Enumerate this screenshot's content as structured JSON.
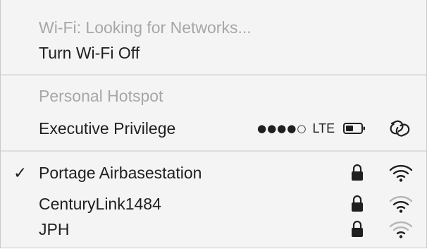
{
  "wifi_status": {
    "label": "Wi-Fi: Looking for Networks..."
  },
  "wifi_toggle": {
    "label": "Turn Wi-Fi Off"
  },
  "hotspot_section": {
    "header": "Personal Hotspot",
    "device": {
      "name": "Executive Privilege",
      "signal_dots": "●●●●○",
      "network_type": "LTE",
      "icons": [
        "battery-icon",
        "link-icon"
      ]
    }
  },
  "networks": [
    {
      "name": "Portage Airbasestation",
      "connected": true,
      "check": "✓",
      "secured": true,
      "icons": [
        "lock-icon",
        "wifi-signal-icon"
      ]
    },
    {
      "name": "CenturyLink1484",
      "connected": false,
      "secured": true,
      "icons": [
        "lock-icon",
        "wifi-signal-icon"
      ]
    },
    {
      "name": "JPH",
      "connected": false,
      "secured": true,
      "icons": [
        "lock-icon",
        "wifi-signal-icon"
      ]
    }
  ],
  "colors": {
    "background": "#f4f4f4",
    "text": "#1f1f1f",
    "header_text": "#a7a7a7",
    "separator": "#dedede",
    "wifi_dim": "#b5b5b5"
  }
}
